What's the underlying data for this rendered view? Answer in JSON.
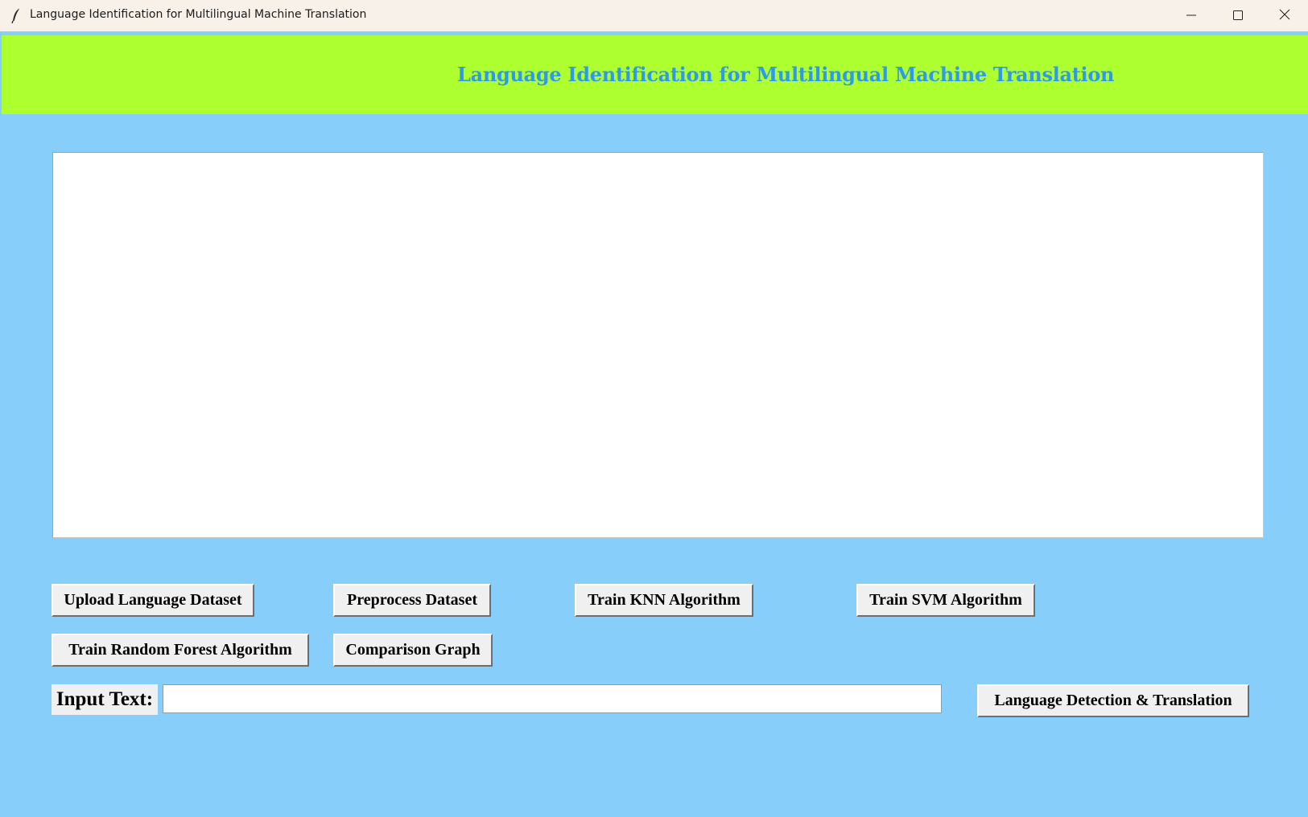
{
  "window": {
    "title": "Language Identification for Multilingual Machine Translation"
  },
  "header": {
    "title": "Language Identification for Multilingual Machine Translation"
  },
  "output": {
    "text": ""
  },
  "buttons": {
    "upload": "Upload Language Dataset",
    "preprocess": "Preprocess Dataset",
    "train_knn": "Train KNN Algorithm",
    "train_svm": "Train SVM Algorithm",
    "train_rf": "Train Random Forest Algorithm",
    "comparison": "Comparison Graph",
    "detect": "Language Detection & Translation"
  },
  "input": {
    "label": "Input Text:",
    "value": ""
  },
  "colors": {
    "background": "#87CEFA",
    "header_bg": "#ADFF2F",
    "header_text": "#2E9AEB",
    "button_bg": "#F0F0F0"
  },
  "icons": {
    "app": "feather-icon",
    "minimize": "minimize-icon",
    "maximize": "maximize-icon",
    "close": "close-icon"
  }
}
